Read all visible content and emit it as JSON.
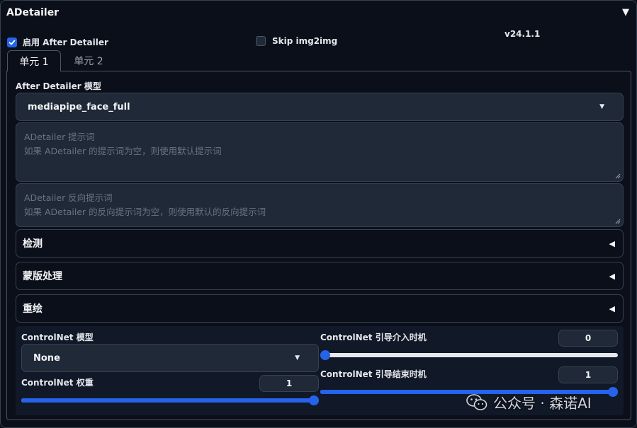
{
  "header": {
    "title": "ADetailer",
    "version": "v24.1.1"
  },
  "checkboxes": {
    "enable": {
      "label": "启用 After Detailer",
      "checked": true
    },
    "skip_img2img": {
      "label": "Skip img2img",
      "checked": false
    }
  },
  "tabs": [
    {
      "label": "单元 1",
      "active": true
    },
    {
      "label": "单元 2",
      "active": false
    }
  ],
  "model": {
    "label": "After Detailer 模型",
    "value": "mediapipe_face_full"
  },
  "prompt": {
    "placeholder_line1": "ADetailer 提示词",
    "placeholder_line2": "如果 ADetailer 的提示词为空，则使用默认提示词"
  },
  "negative_prompt": {
    "placeholder_line1": "ADetailer 反向提示词",
    "placeholder_line2": "如果 ADetailer 的反向提示词为空，则使用默认的反向提示词"
  },
  "accordions": [
    {
      "label": "检测"
    },
    {
      "label": "蒙版处理"
    },
    {
      "label": "重绘"
    }
  ],
  "controlnet": {
    "model_label": "ControlNet 模型",
    "model_value": "None",
    "weight_label": "ControlNet 权重",
    "weight_value": "1",
    "weight_fraction": 1.0,
    "start_label": "ControlNet 引导介入时机",
    "start_value": "0",
    "start_fraction": 0.0,
    "end_label": "ControlNet 引导结束时机",
    "end_value": "1",
    "end_fraction": 1.0
  },
  "watermark": {
    "text": "公众号 · 森诺AI"
  },
  "colors": {
    "accent": "#2563eb",
    "background": "#0b0f19",
    "input_bg": "#1f2937"
  }
}
